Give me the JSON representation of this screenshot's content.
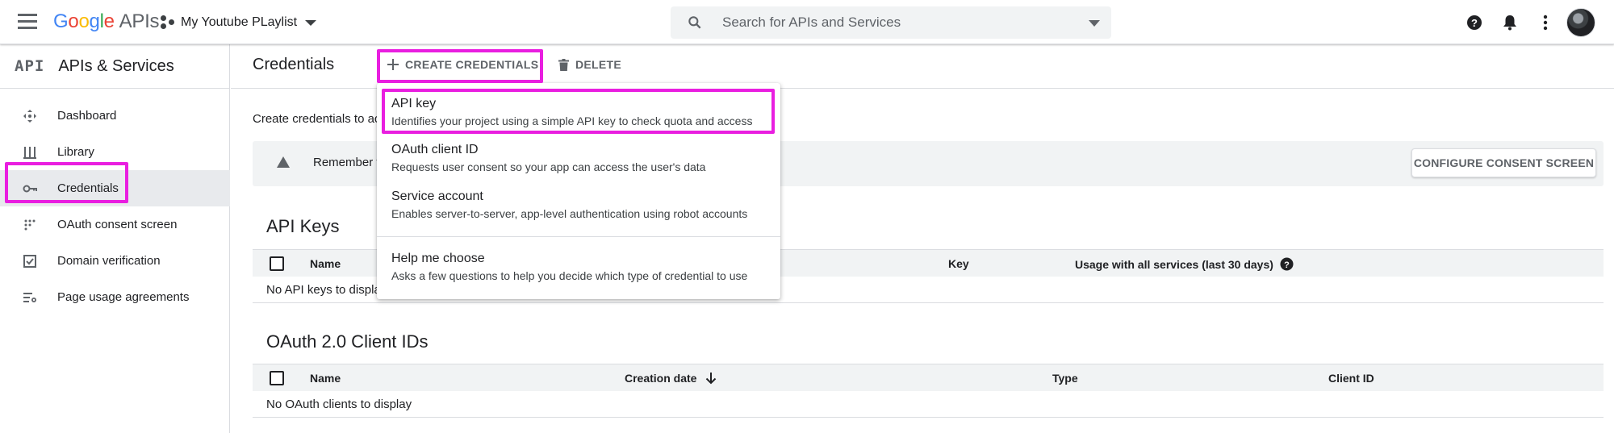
{
  "header": {
    "logo_google": [
      "G",
      "o",
      "o",
      "g",
      "l",
      "e"
    ],
    "logo_apis": "APIs",
    "project_name": "My Youtube PLaylist",
    "search_placeholder": "Search for APIs and Services"
  },
  "sidebar": {
    "mark": "API",
    "title": "APIs & Services",
    "items": [
      {
        "label": "Dashboard",
        "icon": "dashboard-icon"
      },
      {
        "label": "Library",
        "icon": "library-icon"
      },
      {
        "label": "Credentials",
        "icon": "key-icon",
        "active": true
      },
      {
        "label": "OAuth consent screen",
        "icon": "consent-icon"
      },
      {
        "label": "Domain verification",
        "icon": "checkbox-icon"
      },
      {
        "label": "Page usage agreements",
        "icon": "settings-list-icon"
      }
    ]
  },
  "main": {
    "title": "Credentials",
    "create_label": "CREATE CREDENTIALS",
    "delete_label": "DELETE",
    "intro": "Create credentials to ac",
    "banner_text": "Remember t",
    "consent_button": "CONFIGURE CONSENT SCREEN",
    "api_keys": {
      "title": "API Keys",
      "columns": [
        "Name",
        "Key",
        "Usage with all services (last 30 days)"
      ],
      "empty": "No API keys to displa"
    },
    "oauth": {
      "title": "OAuth 2.0 Client IDs",
      "columns": [
        "Name",
        "Creation date",
        "Type",
        "Client ID"
      ],
      "empty": "No OAuth clients to display"
    }
  },
  "menu": {
    "items": [
      {
        "title": "API key",
        "desc": "Identifies your project using a simple API key to check quota and access"
      },
      {
        "title": "OAuth client ID",
        "desc": "Requests user consent so your app can access the user's data"
      },
      {
        "title": "Service account",
        "desc": "Enables server-to-server, app-level authentication using robot accounts"
      },
      {
        "title": "Help me choose",
        "desc": "Asks a few questions to help you decide which type of credential to use"
      }
    ]
  },
  "colors": {
    "highlight": "#e91ee0",
    "active_nav": "#e8eaed",
    "banner_bg": "#f1f3f4"
  }
}
